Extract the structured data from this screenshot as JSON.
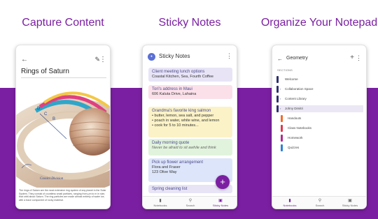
{
  "headlines": {
    "capture": "Capture Content",
    "sticky": "Sticky Notes",
    "organize": "Organize Your Notepad"
  },
  "colors": {
    "brand": "#7b1fa2",
    "nb_blue": "#5b6fd6"
  },
  "phone1": {
    "back_icon": "arrow-left-icon",
    "pen_icon": "pen-icon",
    "more_icon": "more-vertical-icon",
    "page_title": "Rings of Saturn",
    "ring_label_d": "D",
    "ring_label_c": "C",
    "ring_label_b": "B",
    "handwritten_label": "Cassini Division",
    "caption": "The rings of Saturn are the most extensive ring system of any planet in the Solar System. They consist of countless small particles, ranging from µm to m in size, that orbit about Saturn. The ring particles are made almost entirely of water ice, with a trace component of rocky material."
  },
  "phone2": {
    "app_title": "Sticky Notes",
    "app_icon_glyph": "•",
    "more_icon": "more-vertical-icon",
    "notes": [
      {
        "title": "Client meeting lunch options",
        "body": "Coastal Kitchen, Sea, Fourth Coffee",
        "color": "#e8e4f6"
      },
      {
        "title": "Tori's address in Maui",
        "body": "606 Kaluta Drive, Lahaina",
        "color": "#fbe0ea"
      },
      {
        "title": "Grandma's favorite king salmon",
        "lines": [
          "• butter, lemon, sea salt, and pepper",
          "• poach in water, white wine, and lemon",
          "• cook for 5 to 10 minutes..."
        ],
        "color": "#fbf2c7"
      },
      {
        "title": "Daily morning quote",
        "body": "Never be afraid to sit awhile and think",
        "color": "#e1f3dc"
      },
      {
        "title": "Pick up flower arrangement",
        "lines": [
          "Flora and Fraser",
          "123 Olive Way"
        ],
        "color": "#dde5fa"
      },
      {
        "title": "Spring cleaning list",
        "color": "#e8e4f6"
      }
    ],
    "fab_label": "+",
    "nav": {
      "notebooks": "Notebooks",
      "search": "Search",
      "sticky": "Sticky Notes"
    }
  },
  "phone3": {
    "back_glyph": "←",
    "notebook_title": "Geometry",
    "plus_glyph": "+",
    "more_glyph": "⋮",
    "sections_header": "SECTIONS",
    "sections": [
      {
        "label": "Welcome",
        "color": "#2e2e6e",
        "sub": false,
        "chev": ""
      },
      {
        "label": "Collaboration Space",
        "color": "#2e2e6e",
        "sub": false,
        "chev": "›"
      },
      {
        "label": "Content Library",
        "color": "#2e2e6e",
        "sub": false,
        "chev": "›"
      },
      {
        "label": "Johny Dimitri",
        "color": "#2e2e6e",
        "sub": false,
        "chev": "›"
      },
      {
        "label": "Handouts",
        "color": "#f26b2e",
        "sub": true,
        "chev": ""
      },
      {
        "label": "Class Notebooks",
        "color": "#e0384b",
        "sub": true,
        "chev": ""
      },
      {
        "label": "Homework",
        "color": "#b12b8d",
        "sub": true,
        "chev": ""
      },
      {
        "label": "Quizzes",
        "color": "#2f7fd6",
        "sub": true,
        "chev": ""
      }
    ],
    "nav": {
      "notebooks": "Notebooks",
      "search": "Search",
      "sticky": "Sticky Notes"
    }
  }
}
